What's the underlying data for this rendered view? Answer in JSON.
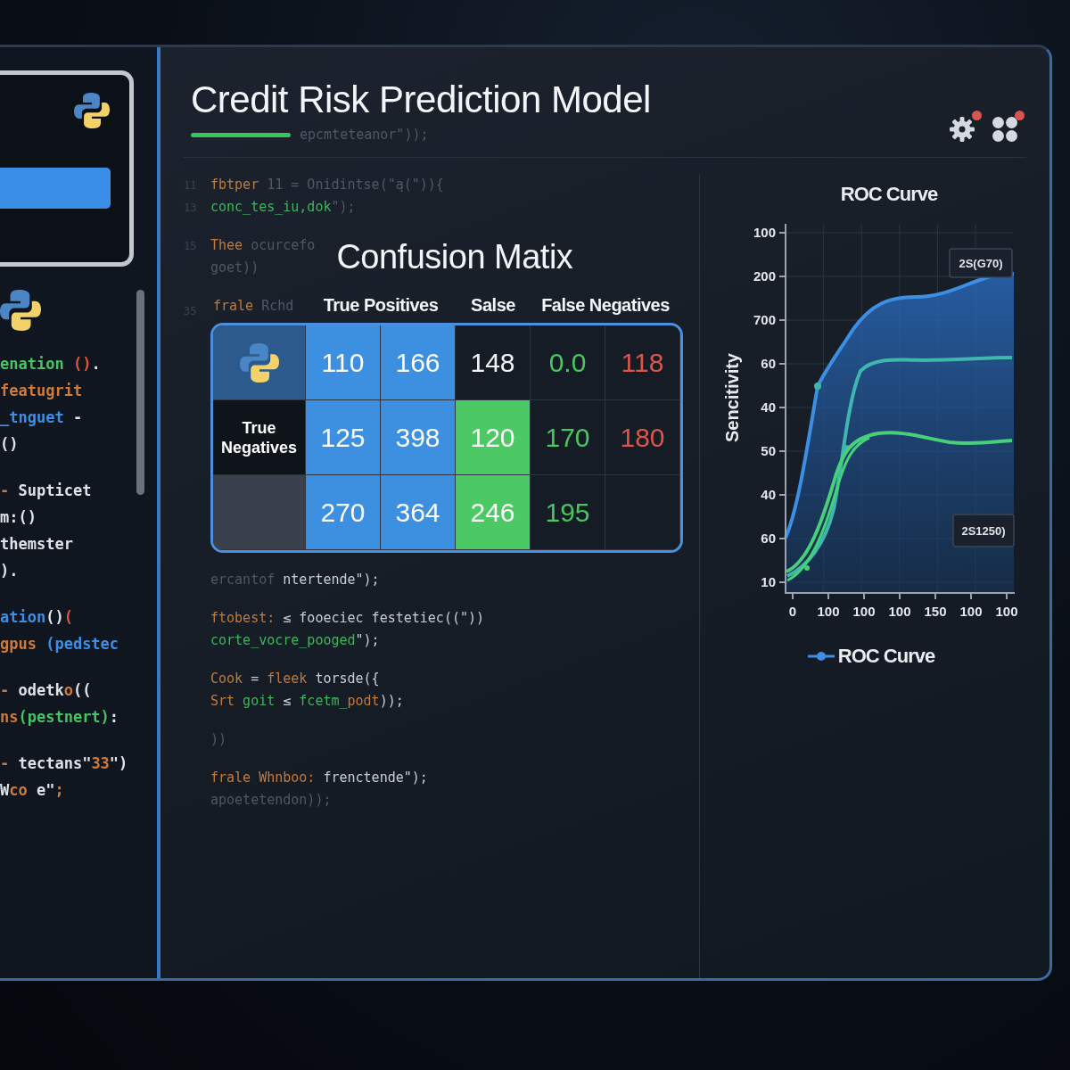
{
  "app": {
    "title": "Credit Risk Prediction Model",
    "toolbar": [
      {
        "badge": true
      },
      {
        "badge": true
      }
    ]
  },
  "sidebar": {
    "code_blocks": [
      {
        "lines": [
          {
            "tokens": [
              {
                "kind": "string",
                "text": "enation"
              },
              {
                "kind": "error",
                "text": " ()"
              },
              {
                "kind": "plain",
                "text": "."
              }
            ]
          },
          {
            "tokens": [
              {
                "kind": "keyword",
                "text": "featugrit"
              }
            ]
          },
          {
            "tokens": [
              {
                "kind": "name",
                "text": "_tnguet"
              },
              {
                "kind": "plain",
                "text": " -"
              }
            ]
          },
          {
            "tokens": [
              {
                "kind": "plain",
                "text": "()"
              }
            ]
          }
        ]
      },
      {
        "lines": [
          {
            "tokens": [
              {
                "kind": "keyword",
                "text": "- "
              },
              {
                "kind": "plain",
                "text": "Supticet"
              }
            ]
          },
          {
            "tokens": [
              {
                "kind": "plain",
                "text": "m:()"
              }
            ]
          },
          {
            "tokens": [
              {
                "kind": "plain",
                "text": "themster"
              }
            ]
          },
          {
            "tokens": [
              {
                "kind": "plain",
                "text": ")."
              }
            ]
          }
        ]
      },
      {
        "lines": [
          {
            "tokens": [
              {
                "kind": "name",
                "text": "ation"
              },
              {
                "kind": "plain",
                "text": "()"
              },
              {
                "kind": "error",
                "text": "("
              }
            ]
          },
          {
            "tokens": [
              {
                "kind": "keyword",
                "text": "gpus"
              },
              {
                "kind": "name",
                "text": " (pedstec"
              }
            ]
          }
        ]
      },
      {
        "lines": [
          {
            "tokens": [
              {
                "kind": "keyword",
                "text": "- "
              },
              {
                "kind": "plain",
                "text": "odetk"
              },
              {
                "kind": "keyword",
                "text": "o"
              },
              {
                "kind": "plain",
                "text": "(("
              }
            ]
          },
          {
            "tokens": [
              {
                "kind": "keyword",
                "text": "ns"
              },
              {
                "kind": "string",
                "text": "(pestnert)"
              },
              {
                "kind": "plain",
                "text": ":"
              }
            ]
          }
        ]
      },
      {
        "lines": [
          {
            "tokens": [
              {
                "kind": "keyword",
                "text": "- "
              },
              {
                "kind": "plain",
                "text": "tectans\""
              },
              {
                "kind": "keyword",
                "text": "33"
              },
              {
                "kind": "plain",
                "text": "\")"
              }
            ]
          },
          {
            "tokens": [
              {
                "kind": "plain",
                "text": "W"
              },
              {
                "kind": "keyword",
                "text": "co"
              },
              {
                "kind": "plain",
                "text": " e\""
              },
              {
                "kind": "keyword",
                "text": ";"
              }
            ]
          }
        ]
      }
    ]
  },
  "editor": {
    "code_blocks": [
      {
        "lines": [
          {
            "tokens": [
              {
                "kind": "dim",
                "text": "epcmteteanor\"));"
              }
            ]
          }
        ]
      },
      {
        "lines": [
          {
            "number": "11",
            "tokens": [
              {
                "kind": "keyword",
                "text": "fbtper"
              },
              {
                "kind": "dim",
                "text": " 11 = Onidintse(\"ą(\")){"
              }
            ]
          },
          {
            "number": "13",
            "tokens": [
              {
                "kind": "string",
                "text": "conc_tes_iu,dok"
              },
              {
                "kind": "dim",
                "text": "\");"
              }
            ]
          }
        ]
      },
      {
        "lines": [
          {
            "number": "15",
            "tokens": [
              {
                "kind": "keyword",
                "text": "Thee"
              },
              {
                "kind": "dim",
                "text": " ocurcefo"
              }
            ]
          },
          {
            "tokens": [
              {
                "kind": "dim",
                "text": "goet))"
              }
            ]
          }
        ]
      },
      {
        "lines": [
          {
            "number": "35",
            "tokens": [
              {
                "kind": "keyword",
                "text": "frale"
              },
              {
                "kind": "dim",
                "text": " Rchd"
              }
            ]
          }
        ]
      },
      {
        "lines": [
          {
            "tokens": [
              {
                "kind": "dim",
                "text": "ercantof"
              },
              {
                "kind": "plain",
                "text": " ntertende\");"
              }
            ]
          }
        ]
      },
      {
        "lines": [
          {
            "tokens": [
              {
                "kind": "keyword",
                "text": "ftobest:"
              },
              {
                "kind": "plain",
                "text": " ≤ fooeciec festetiec((\"))"
              }
            ]
          },
          {
            "tokens": [
              {
                "kind": "string",
                "text": "corte_vocre_pooged"
              },
              {
                "kind": "plain",
                "text": "\");"
              }
            ]
          }
        ]
      },
      {
        "lines": [
          {
            "tokens": [
              {
                "kind": "keyword",
                "text": "Cook"
              },
              {
                "kind": "plain",
                "text": " = "
              },
              {
                "kind": "keyword",
                "text": "fleek"
              },
              {
                "kind": "plain",
                "text": " torsde({"
              }
            ]
          },
          {
            "tokens": [
              {
                "kind": "keyword",
                "text": "Srt"
              },
              {
                "kind": "string",
                "text": " goit"
              },
              {
                "kind": "plain",
                "text": " ≤ "
              },
              {
                "kind": "string",
                "text": "fcetm_"
              },
              {
                "kind": "keyword",
                "text": "podt"
              },
              {
                "kind": "plain",
                "text": "));"
              }
            ]
          }
        ]
      },
      {
        "lines": [
          {
            "tokens": [
              {
                "kind": "dim",
                "text": "))"
              }
            ]
          }
        ]
      },
      {
        "lines": [
          {
            "tokens": [
              {
                "kind": "keyword",
                "text": "frale Whnboo:"
              },
              {
                "kind": "plain",
                "text": " frenctende\");"
              }
            ]
          },
          {
            "tokens": [
              {
                "kind": "dim",
                "text": "apoetetendon));"
              }
            ]
          }
        ]
      }
    ]
  },
  "confusion_matrix": {
    "title": "Confusion Matix",
    "column_headers": [
      {
        "kind": "pair",
        "text": "True Positives"
      },
      {
        "kind": "single",
        "text": "Salse"
      },
      {
        "kind": "pair",
        "text": "False Negatives"
      }
    ],
    "rows": [
      {
        "header": {
          "kind": "logo"
        },
        "cells": [
          {
            "kind": "positive",
            "value": "110"
          },
          {
            "kind": "positive",
            "value": "166"
          },
          {
            "kind": "neutral",
            "value": "148"
          },
          {
            "kind": "good",
            "value": "0.0"
          },
          {
            "kind": "bad",
            "value": "118"
          }
        ]
      },
      {
        "header": {
          "kind": "label",
          "text": "True Negatives"
        },
        "cells": [
          {
            "kind": "positive",
            "value": "125"
          },
          {
            "kind": "positive",
            "value": "398"
          },
          {
            "kind": "highlight",
            "value": "120"
          },
          {
            "kind": "good",
            "value": "170"
          },
          {
            "kind": "bad",
            "value": "180"
          }
        ]
      },
      {
        "header": {
          "kind": "blank"
        },
        "cells": [
          {
            "kind": "positive",
            "value": "270"
          },
          {
            "kind": "positive",
            "value": "364"
          },
          {
            "kind": "highlight",
            "value": "246"
          },
          {
            "kind": "good",
            "value": "195"
          },
          {
            "kind": "empty"
          }
        ]
      }
    ]
  },
  "roc_chart": {
    "title": "ROC Curve",
    "ylabel": "Sencitivity",
    "y_tick_labels": [
      "100",
      "200",
      "700",
      "60",
      "40",
      "50",
      "40",
      "60",
      "10"
    ],
    "x_tick_labels": [
      "0",
      "100",
      "100",
      "100",
      "150",
      "100",
      "100"
    ],
    "annotations": [
      "2S(G70)",
      "2S1250)"
    ],
    "legend": "ROC Curve"
  }
}
